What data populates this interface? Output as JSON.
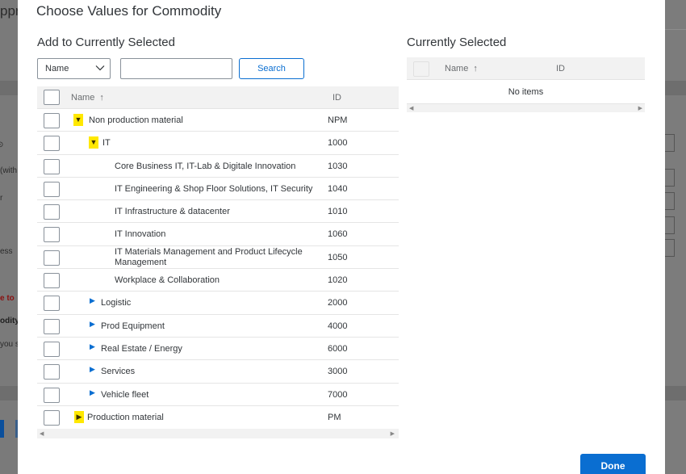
{
  "background": {
    "left_fragments": [
      "ppr",
      "(with",
      "r",
      "ess",
      "e to",
      "odity",
      "you s"
    ],
    "accent_blue": "#0a4f9c"
  },
  "dialog": {
    "title": "Choose Values for Commodity",
    "left_section_title": "Add to Currently Selected",
    "right_section_title": "Currently Selected",
    "filter_select_value": "Name",
    "search_input_value": "",
    "search_button_label": "Search",
    "done_button_label": "Done"
  },
  "left_table": {
    "col_name": "Name",
    "col_id": "ID",
    "sort_icon": "↑",
    "rows": [
      {
        "name": "Non production material",
        "id": "NPM",
        "level": 0,
        "toggle": "expanded",
        "highlight": true
      },
      {
        "name": "IT",
        "id": "1000",
        "level": 1,
        "toggle": "expanded",
        "highlight": true
      },
      {
        "name": "Core Business IT, IT-Lab & Digitale Innovation",
        "id": "1030",
        "level": 2,
        "toggle": "none"
      },
      {
        "name": "IT Engineering & Shop Floor Solutions, IT Security",
        "id": "1040",
        "level": 2,
        "toggle": "none"
      },
      {
        "name": "IT Infrastructure & datacenter",
        "id": "1010",
        "level": 2,
        "toggle": "none"
      },
      {
        "name": "IT Innovation",
        "id": "1060",
        "level": 2,
        "toggle": "none"
      },
      {
        "name": "IT Materials Management and Product Lifecycle Management",
        "id": "1050",
        "level": 2,
        "toggle": "none"
      },
      {
        "name": "Workplace & Collaboration",
        "id": "1020",
        "level": 2,
        "toggle": "none"
      },
      {
        "name": "Logistic",
        "id": "2000",
        "level": 1,
        "toggle": "collapsed"
      },
      {
        "name": "Prod Equipment",
        "id": "4000",
        "level": 1,
        "toggle": "collapsed"
      },
      {
        "name": "Real Estate / Energy",
        "id": "6000",
        "level": 1,
        "toggle": "collapsed"
      },
      {
        "name": "Services",
        "id": "3000",
        "level": 1,
        "toggle": "collapsed"
      },
      {
        "name": "Vehicle fleet",
        "id": "7000",
        "level": 1,
        "toggle": "collapsed"
      },
      {
        "name": "Production material",
        "id": "PM",
        "level": 0,
        "toggle": "collapsed",
        "highlight": true
      }
    ]
  },
  "right_table": {
    "col_name": "Name",
    "col_id": "ID",
    "sort_icon": "↑",
    "empty_text": "No items"
  },
  "colors": {
    "accent": "#0a6ed1",
    "highlight": "#ffe800"
  }
}
